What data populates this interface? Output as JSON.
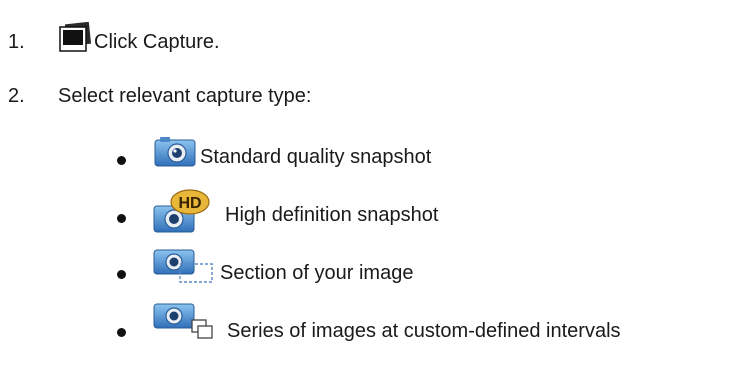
{
  "steps": [
    {
      "number": "1.",
      "text": "Click Capture."
    },
    {
      "number": "2.",
      "text": "Select relevant capture type:"
    }
  ],
  "capture_types": [
    {
      "icon": "camera-snapshot-icon",
      "label": "Standard quality snapshot"
    },
    {
      "icon": "camera-hd-snapshot-icon",
      "label": "High definition snapshot"
    },
    {
      "icon": "camera-section-icon",
      "label": "Section of your image"
    },
    {
      "icon": "camera-series-icon",
      "label": "Series of images at custom-defined intervals"
    }
  ],
  "colors": {
    "text": "#1a1a1a",
    "camera_blue": "#3a7fc8",
    "hd_badge": "#e8b73a"
  }
}
